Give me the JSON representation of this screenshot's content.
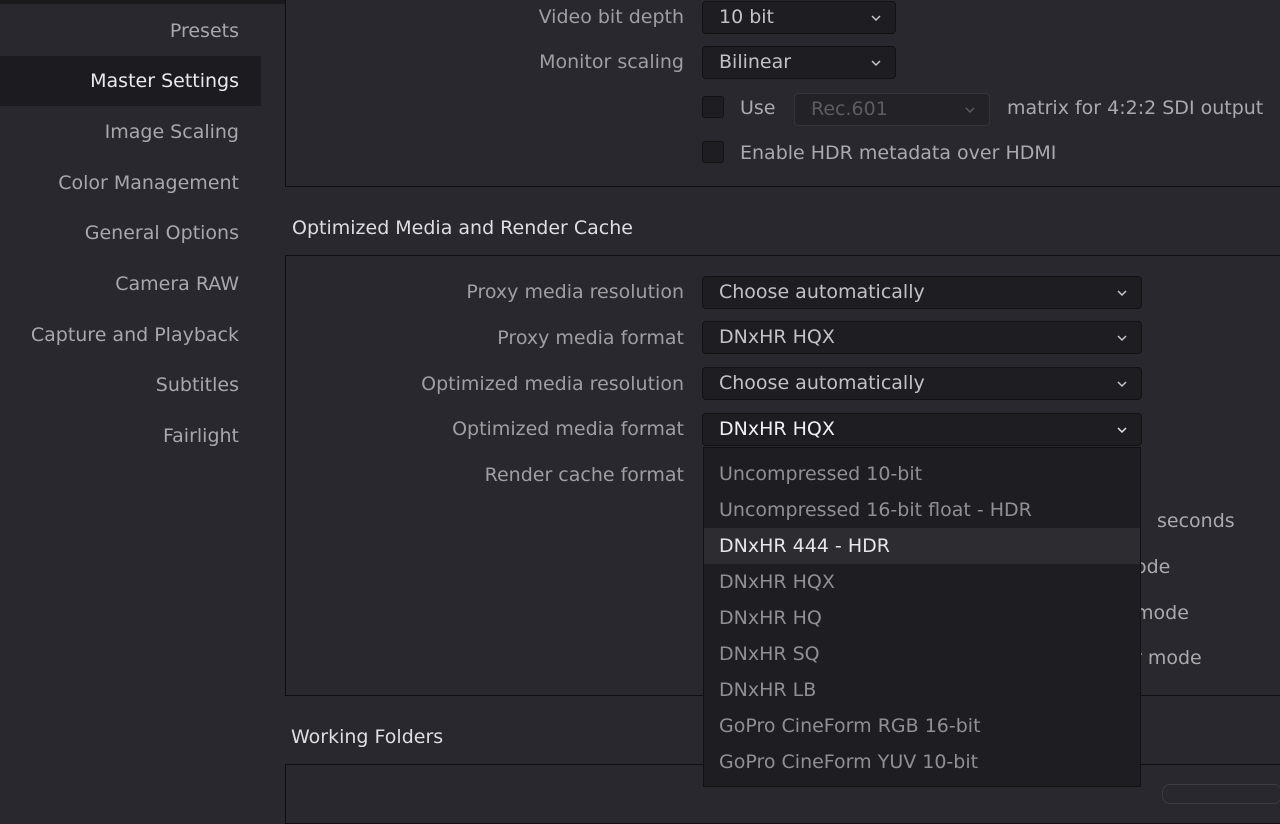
{
  "sidebar": {
    "items": [
      {
        "label": "Presets"
      },
      {
        "label": "Master Settings",
        "active": true
      },
      {
        "label": "Image Scaling"
      },
      {
        "label": "Color Management"
      },
      {
        "label": "General Options"
      },
      {
        "label": "Camera RAW"
      },
      {
        "label": "Capture and Playback"
      },
      {
        "label": "Subtitles"
      },
      {
        "label": "Fairlight"
      }
    ]
  },
  "video_monitoring": {
    "bit_depth": {
      "label": "Video bit depth",
      "value": "10 bit"
    },
    "monitor_scaling": {
      "label": "Monitor scaling",
      "value": "Bilinear"
    },
    "use_matrix": {
      "label_before": "Use",
      "value": "Rec.601",
      "label_after": "matrix for 4:2:2 SDI output",
      "checked": false
    },
    "hdr_metadata": {
      "label": "Enable HDR metadata over HDMI",
      "checked": false
    }
  },
  "optimized_media": {
    "title": "Optimized Media and Render Cache",
    "proxy_resolution": {
      "label": "Proxy media resolution",
      "value": "Choose automatically"
    },
    "proxy_format": {
      "label": "Proxy media format",
      "value": "DNxHR HQX"
    },
    "optimized_resolution": {
      "label": "Optimized media resolution",
      "value": "Choose automatically"
    },
    "optimized_format": {
      "label": "Optimized media format",
      "value": "DNxHR HQX"
    },
    "render_cache": {
      "label": "Render cache format"
    },
    "partial_labels": [
      "seconds",
      "ode",
      "mode",
      "r mode"
    ],
    "menu_options": [
      "Uncompressed 10-bit",
      "Uncompressed 16-bit float - HDR",
      "DNxHR 444 - HDR",
      "DNxHR HQX",
      "DNxHR HQ",
      "DNxHR SQ",
      "DNxHR LB",
      "GoPro CineForm RGB 16-bit",
      "GoPro CineForm YUV 10-bit"
    ],
    "highlighted_option": "DNxHR 444 - HDR"
  },
  "working_folders": {
    "title": "Working Folders"
  },
  "colors": {
    "background": "#28282e",
    "sidebar_active": "#1c1c20",
    "dropdown_bg": "#1e1e22",
    "menu_highlight": "#2c2c31"
  }
}
